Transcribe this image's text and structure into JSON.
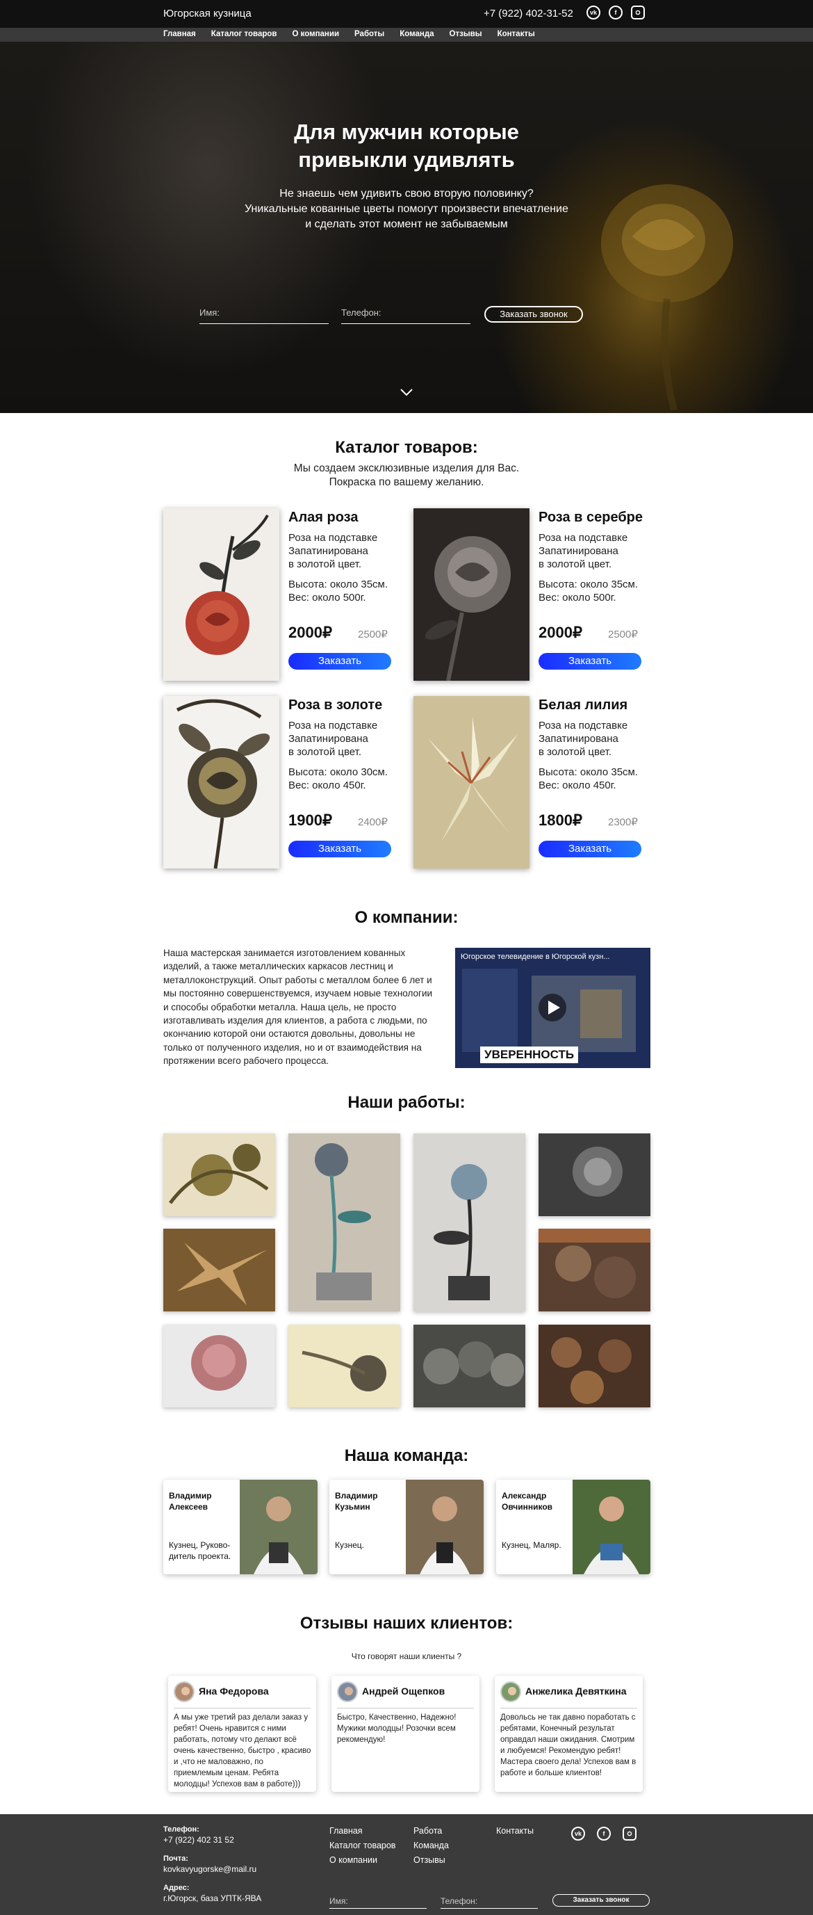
{
  "header": {
    "brand": "Югорская кузница",
    "phone": "+7 (922) 402-31-52",
    "socials": [
      "vk-icon",
      "facebook-icon",
      "instagram-icon"
    ]
  },
  "nav": [
    "Главная",
    "Каталог товаров",
    "О компании",
    "Работы",
    "Команда",
    "Отзывы",
    "Контакты"
  ],
  "hero": {
    "title_line1": "Для мужчин которые",
    "title_line2": "привыкли удивлять",
    "sub_line1": "Не знаешь чем удивить свою вторую половинку?",
    "sub_line2": "Уникальные кованные цветы помогут произвести впечатление",
    "sub_line3": "и сделать этот момент не забываемым",
    "name_placeholder": "Имя:",
    "phone_placeholder": "Телефон:",
    "call_button": "Заказать звонок"
  },
  "catalog": {
    "title": "Каталог товаров:",
    "sub_line1": "Мы создаем эксклюзивные изделия для Вас.",
    "sub_line2": "Покраска по вашему желанию.",
    "order_label": "Заказать",
    "items": [
      {
        "name": "Алая роза",
        "desc": "Роза на подставке\nЗапатинирована\nв золотой цвет.",
        "dims": "Высота: около 35см.\nВес: около 500г.",
        "price": "2000₽",
        "old": "2500₽"
      },
      {
        "name": "Роза в серебре",
        "desc": "Роза на подставке\nЗапатинирована\nв золотой цвет.",
        "dims": "Высота: около 35см.\nВес: около 500г.",
        "price": "2000₽",
        "old": "2500₽"
      },
      {
        "name": "Роза в золоте",
        "desc": "Роза на подставке\nЗапатинирована\nв золотой цвет.",
        "dims": "Высота: около 30см.\nВес: около 450г.",
        "price": "1900₽",
        "old": "2400₽"
      },
      {
        "name": "Белая лилия",
        "desc": "Роза на подставке\nЗапатинирована\nв золотой цвет.",
        "dims": "Высота: около 35см.\nВес: около 450г.",
        "price": "1800₽",
        "old": "2300₽"
      }
    ]
  },
  "about": {
    "title": "О компании:",
    "text": "Наша мастерская занимается изготовлением кованных изделий, а также металлических каркасов лестниц и металлоконструкций. Опыт работы с металлом более 6 лет и мы постоянно совершенствуемся, изучаем новые технологии и способы обработки металла. Наша цель, не просто изготавливать изделия для клиентов, а работа с людьми, по окончанию которой они остаются довольны, довольны не только от полученного изделия, но и от взаимодействия на протяжении всего рабочего процесса.",
    "video_title": "Югорское телевидение в Югорской кузн...",
    "video_badge": "УВЕРЕННОСТЬ"
  },
  "works": {
    "title": "Наши работы:"
  },
  "team": {
    "title": "Наша команда:",
    "members": [
      {
        "name": "Владимир\nАлексеев",
        "role": "Кузнец, Руково-\nдитель проекта."
      },
      {
        "name": "Владимир\nКузьмин",
        "role": "Кузнец."
      },
      {
        "name": "Александр\nОвчинников",
        "role": "Кузнец, Маляр."
      }
    ]
  },
  "reviews": {
    "title": "Отзывы наших клиентов:",
    "sub": "Что говорят наши клиенты ?",
    "items": [
      {
        "name": "Яна Федорова",
        "text": "А мы уже третий раз делали заказ у ребят! Очень нравится с ними работать, потому что делают всё очень качественно, быстро , красиво и ,что не маловажно, по приемлемым ценам. Ребята молодцы! Успехов вам в работе)))"
      },
      {
        "name": "Андрей Ощепков",
        "text": "Быстро, Качественно, Надежно! Мужики молодцы! Розочки всем рекомендую!"
      },
      {
        "name": "Анжелика Девяткина",
        "text": "Довольсь не так давно поработать с ребятами, Конечный результат оправдал наши ожидания. Смотрим и любуемся! Рекомендую ребят! Мастера своего дела! Успехов вам в работе и больше клиентов!"
      }
    ]
  },
  "footer": {
    "phone_label": "Телефон:",
    "phone": "+7 (922) 402 31 52",
    "mail_label": "Почта:",
    "mail": "kovkavyugorske@mail.ru",
    "addr_label": "Адрес:",
    "addr": "г.Югорск, база УПТК-ЯВА",
    "links_col1": [
      "Главная",
      "Каталог товаров",
      "О компании"
    ],
    "links_col2": [
      "Работа",
      "Команда",
      "Отзывы"
    ],
    "links_col3": [
      "Контакты"
    ],
    "name_placeholder": "Имя:",
    "phone_placeholder": "Телефон:",
    "call_button": "Заказать звонок"
  }
}
